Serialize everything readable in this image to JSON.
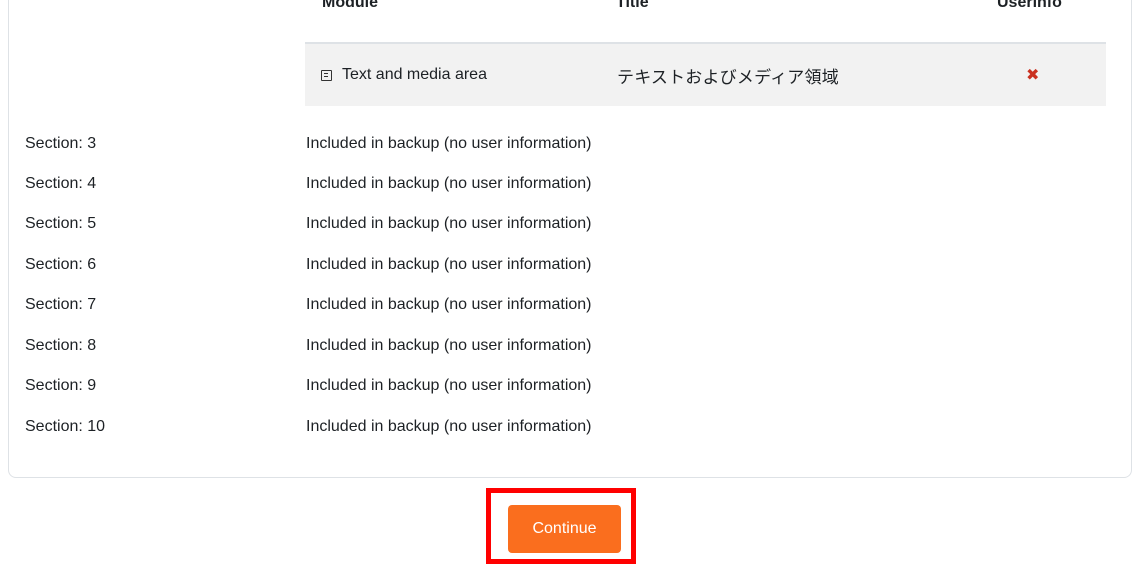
{
  "module_table": {
    "headers": [
      "Module",
      "Title",
      "Userinfo"
    ],
    "rows": [
      {
        "module": "Text and media area",
        "icon": "page-icon",
        "title": "テキストおよびメディア領域",
        "userinfo": "✖"
      }
    ]
  },
  "sections": [
    {
      "label": "Section: 3",
      "status": "Included in backup (no user information)"
    },
    {
      "label": "Section: 4",
      "status": "Included in backup (no user information)"
    },
    {
      "label": "Section: 5",
      "status": "Included in backup (no user information)"
    },
    {
      "label": "Section: 6",
      "status": "Included in backup (no user information)"
    },
    {
      "label": "Section: 7",
      "status": "Included in backup (no user information)"
    },
    {
      "label": "Section: 8",
      "status": "Included in backup (no user information)"
    },
    {
      "label": "Section: 9",
      "status": "Included in backup (no user information)"
    },
    {
      "label": "Section: 10",
      "status": "Included in backup (no user information)"
    }
  ],
  "actions": {
    "continue_label": "Continue"
  },
  "colors": {
    "primary_button": "#fa6e1e",
    "highlight_border": "#ff0000",
    "not_included_mark": "#ca3120"
  }
}
